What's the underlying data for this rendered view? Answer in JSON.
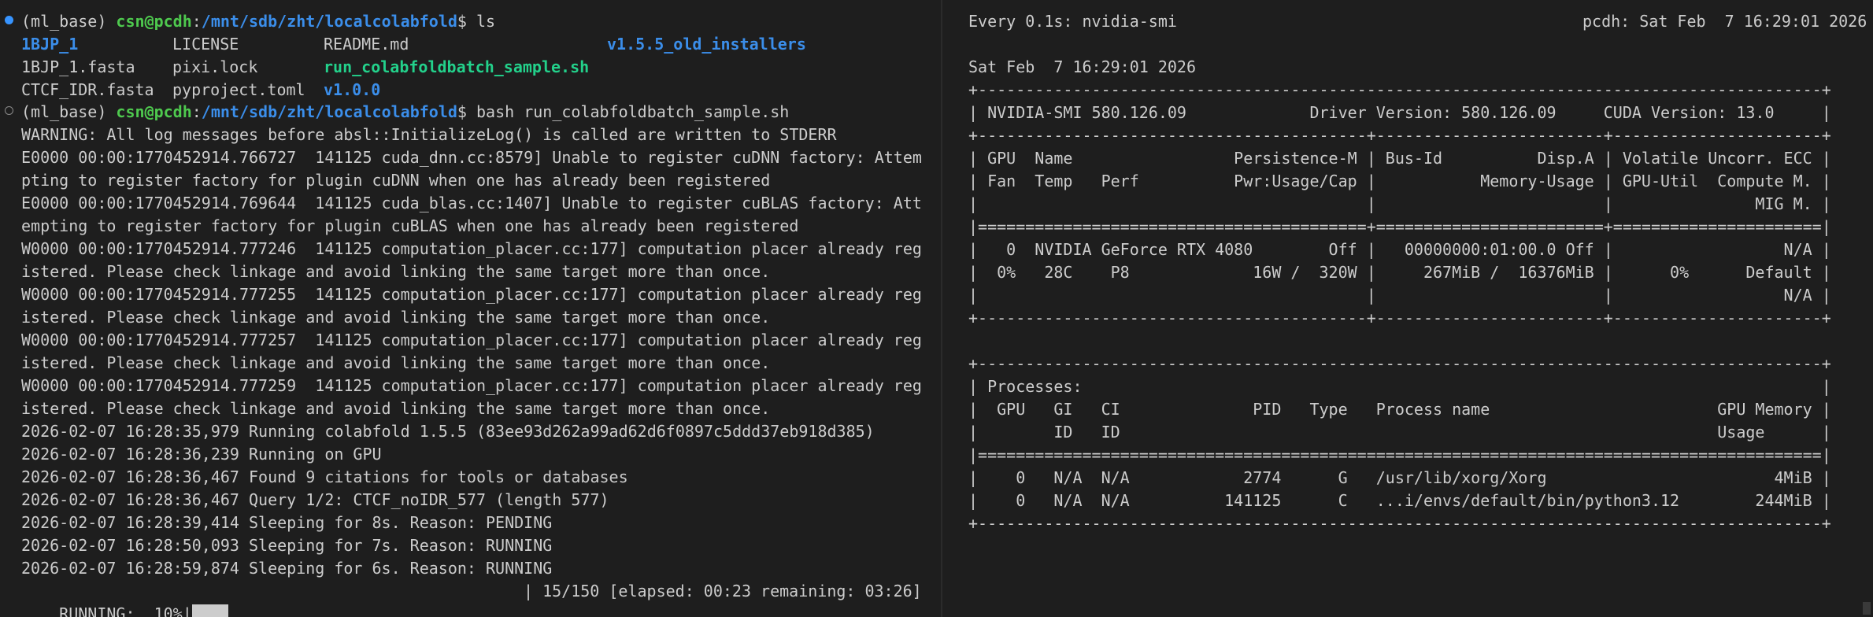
{
  "left_terminal": {
    "prompt1": {
      "env": "(ml_base) ",
      "user_host": "csn@pcdh",
      "colon": ":",
      "path": "/mnt/sdb/zht/localcolabfold",
      "suffix": "$ ls"
    },
    "ls_rows": [
      {
        "c1": "1BJP_1",
        "c2": "LICENSE",
        "c3": "README.md",
        "c4": "v1.5.5_old_installers"
      },
      {
        "c1": "1BJP_1.fasta",
        "c2": "pixi.lock",
        "c3": "run_colabfoldbatch_sample.sh",
        "c4": ""
      },
      {
        "c1": "CTCF_IDR.fasta",
        "c2": "pyproject.toml",
        "c3": "v1.0.0",
        "c4": ""
      }
    ],
    "prompt2": {
      "env": "(ml_base) ",
      "user_host": "csn@pcdh",
      "colon": ":",
      "path": "/mnt/sdb/zht/localcolabfold",
      "suffix": "$ bash run_colabfoldbatch_sample.sh"
    },
    "output_lines": [
      "WARNING: All log messages before absl::InitializeLog() is called are written to STDERR",
      "E0000 00:00:1770452914.766727  141125 cuda_dnn.cc:8579] Unable to register cuDNN factory: Attem",
      "pting to register factory for plugin cuDNN when one has already been registered",
      "E0000 00:00:1770452914.769644  141125 cuda_blas.cc:1407] Unable to register cuBLAS factory: Att",
      "empting to register factory for plugin cuBLAS when one has already been registered",
      "W0000 00:00:1770452914.777246  141125 computation_placer.cc:177] computation placer already reg",
      "istered. Please check linkage and avoid linking the same target more than once.",
      "W0000 00:00:1770452914.777255  141125 computation_placer.cc:177] computation placer already reg",
      "istered. Please check linkage and avoid linking the same target more than once.",
      "W0000 00:00:1770452914.777257  141125 computation_placer.cc:177] computation placer already reg",
      "istered. Please check linkage and avoid linking the same target more than once.",
      "W0000 00:00:1770452914.777259  141125 computation_placer.cc:177] computation placer already reg",
      "istered. Please check linkage and avoid linking the same target more than once.",
      "2026-02-07 16:28:35,979 Running colabfold 1.5.5 (83ee93d262a99ad62d6f0897c5ddd37eb918d385)",
      "2026-02-07 16:28:36,239 Running on GPU",
      "2026-02-07 16:28:36,467 Found 9 citations for tools or databases",
      "2026-02-07 16:28:36,467 Query 1/2: CTCF_noIDR_577 (length 577)",
      "2026-02-07 16:28:39,414 Sleeping for 8s. Reason: PENDING",
      "2026-02-07 16:28:50,093 Sleeping for 7s. Reason: RUNNING",
      "2026-02-07 16:28:59,874 Sleeping for 6s. Reason: RUNNING"
    ],
    "progress": {
      "label": "RUNNING:  10%|",
      "fraction": 0.1,
      "status": "| 15/150 [elapsed: 00:23 remaining: 03:26]"
    }
  },
  "right_terminal": {
    "watch_header": "Every 0.1s: nvidia-smi",
    "host_time": "pcdh: Sat Feb  7 16:29:01 2026",
    "smi_lines": [
      "Sat Feb  7 16:29:01 2026",
      "+-----------------------------------------------------------------------------------------+",
      "| NVIDIA-SMI 580.126.09             Driver Version: 580.126.09     CUDA Version: 13.0     |",
      "+-----------------------------------------+------------------------+----------------------+",
      "| GPU  Name                 Persistence-M | Bus-Id          Disp.A | Volatile Uncorr. ECC |",
      "| Fan  Temp   Perf          Pwr:Usage/Cap |           Memory-Usage | GPU-Util  Compute M. |",
      "|                                         |                        |               MIG M. |",
      "|=========================================+========================+======================|",
      "|   0  NVIDIA GeForce RTX 4080        Off |   00000000:01:00.0 Off |                  N/A |",
      "|  0%   28C    P8             16W /  320W |     267MiB /  16376MiB |      0%      Default |",
      "|                                         |                        |                  N/A |",
      "+-----------------------------------------+------------------------+----------------------+",
      "",
      "+-----------------------------------------------------------------------------------------+",
      "| Processes:                                                                              |",
      "|  GPU   GI   CI              PID   Type   Process name                        GPU Memory |",
      "|        ID   ID                                                               Usage      |",
      "|=========================================================================================|",
      "|    0   N/A  N/A            2774      G   /usr/lib/xorg/Xorg                        4MiB |",
      "|    0   N/A  N/A          141125      C   ...i/envs/default/bin/python3.12        244MiB |",
      "+-----------------------------------------------------------------------------------------+"
    ]
  }
}
